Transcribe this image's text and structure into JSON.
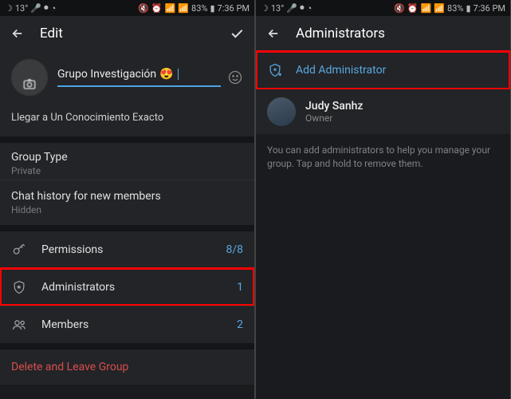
{
  "status": {
    "temp": "13°",
    "battery": "83%",
    "time": "7:36 PM"
  },
  "left": {
    "header_title": "Edit",
    "group_name": "Grupo Investigación",
    "description": "Llegar a Un Conocimiento Exacto",
    "group_type_label": "Group Type",
    "group_type_value": "Private",
    "chat_history_label": "Chat history for new members",
    "chat_history_value": "Hidden",
    "permissions_label": "Permissions",
    "permissions_value": "8/8",
    "administrators_label": "Administrators",
    "administrators_value": "1",
    "members_label": "Members",
    "members_value": "2",
    "delete_label": "Delete and Leave Group"
  },
  "right": {
    "header_title": "Administrators",
    "add_label": "Add Administrator",
    "owner_name": "Judy Sanhz",
    "owner_role": "Owner",
    "hint": "You can add administrators to help you manage your group. Tap and hold to remove them."
  }
}
